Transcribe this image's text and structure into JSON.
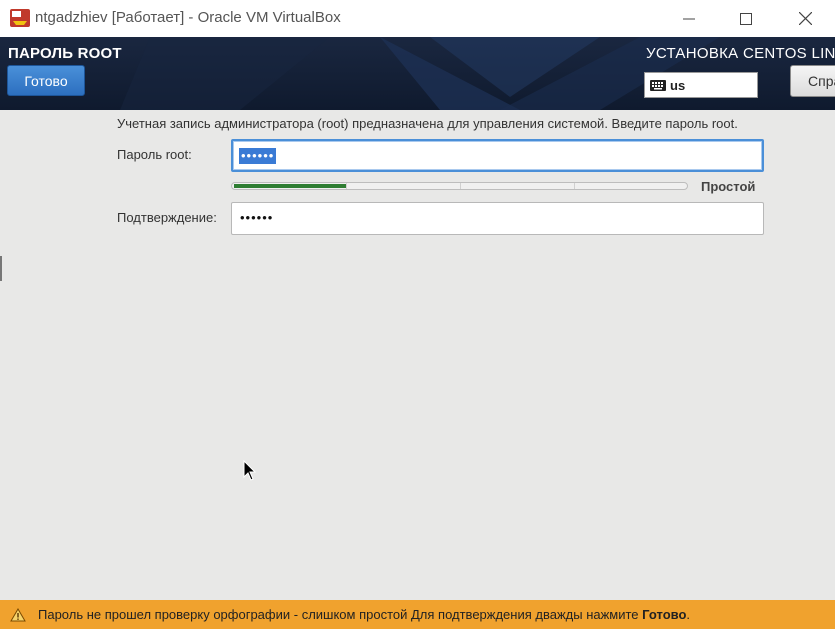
{
  "window": {
    "title": "ntgadzhiev [Работает] - Oracle VM VirtualBox",
    "icon": "virtualbox-icon"
  },
  "header": {
    "spoke_title": "ПАРОЛЬ ROOT",
    "done_label": "Готово",
    "product_title": "УСТАНОВКА CENTOS LIN",
    "keyboard_layout": "us",
    "help_label": "Спра"
  },
  "form": {
    "description": "Учетная запись администратора (root) предназначена для управления системой. Введите пароль root.",
    "password_label": "Пароль root:",
    "password_value": "••••••",
    "strength_label": "Простой",
    "strength_fraction": 0.25,
    "confirm_label": "Подтверждение:",
    "confirm_value": "••••••"
  },
  "warning": {
    "message": "Пароль не прошел проверку орфографии - слишком простой Для подтверждения дважды нажмите ",
    "emphasis": "Готово",
    "suffix": "."
  },
  "colors": {
    "warning_bar": "#f0a22e",
    "done_button": "#3b7fcc",
    "strength_fill": "#2e7d32",
    "header_bg": "#14203a"
  }
}
